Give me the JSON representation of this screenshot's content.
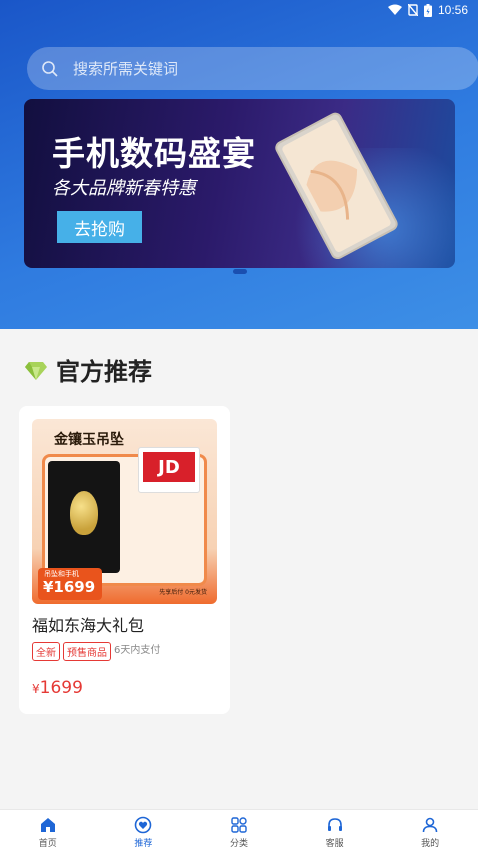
{
  "status": {
    "time": "10:56"
  },
  "search": {
    "placeholder": "搜索所需关键词"
  },
  "banner": {
    "title": "手机数码盛宴",
    "subtitle": "各大品牌新春特惠",
    "cta": "去抢购"
  },
  "section": {
    "title": "官方推荐"
  },
  "product": {
    "image": {
      "title": "金镶玉吊坠",
      "jd": "JD",
      "price_label": "吊坠和手机",
      "price": "¥1699",
      "note": "先享后付  0元发货"
    },
    "name": "福如东海大礼包",
    "tags": [
      "全新",
      "预售商品"
    ],
    "pay_note": "6天内支付",
    "currency": "¥",
    "price": "1699"
  },
  "tabs": [
    {
      "label": "首页",
      "icon": "home-icon",
      "active": false
    },
    {
      "label": "推荐",
      "icon": "heart-icon",
      "active": true
    },
    {
      "label": "分类",
      "icon": "grid-icon",
      "active": false
    },
    {
      "label": "客服",
      "icon": "headset-icon",
      "active": false
    },
    {
      "label": "我的",
      "icon": "user-icon",
      "active": false
    }
  ],
  "colors": {
    "accent": "#1e66d6",
    "price": "#e53935"
  }
}
